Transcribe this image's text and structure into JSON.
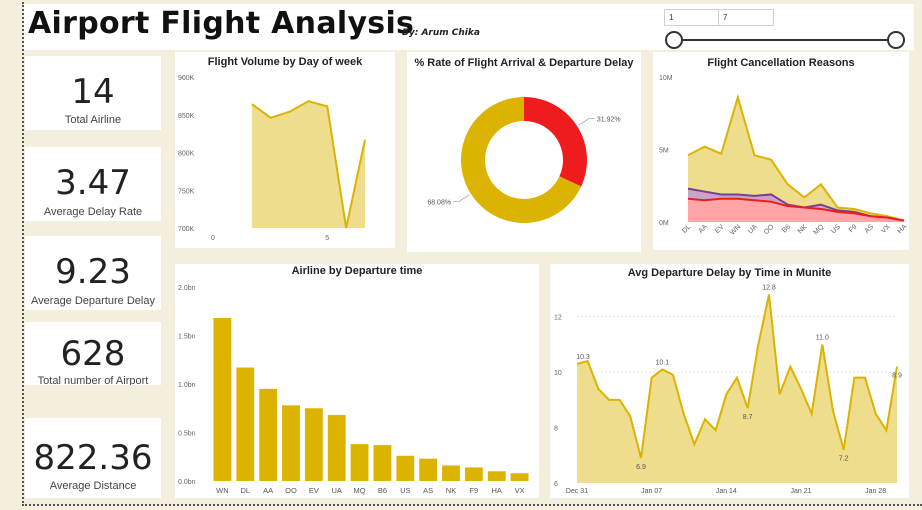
{
  "header": {
    "title": "Airport Flight Analysis",
    "byline": "By: Arum Chika"
  },
  "slicer": {
    "min": "1",
    "max": "7"
  },
  "colors": {
    "gold": "#dbb300",
    "goldFill": "#eedd8c",
    "red": "#ee1c1c",
    "purple": "#7b3f8f",
    "salmon": "#ffa5a5"
  },
  "kpis": [
    {
      "value": "14",
      "label": "Total Airline"
    },
    {
      "value": "3.47",
      "label": "Average Delay Rate"
    },
    {
      "value": "9.23",
      "label": "Average Departure Delay"
    },
    {
      "value": "628",
      "label": "Total number of  Airport"
    },
    {
      "value": "822.36",
      "label": "Average Distance"
    }
  ],
  "chart_data": [
    {
      "id": "volume",
      "type": "area",
      "title": "Flight Volume by Day of week",
      "x": [
        1,
        2,
        3,
        4,
        5,
        6,
        7
      ],
      "y": [
        864000,
        846000,
        854000,
        868000,
        861000,
        700000,
        817000
      ],
      "ylim": [
        700000,
        900000
      ],
      "yticks": [
        "900K",
        "850K",
        "800K",
        "750K",
        "700K"
      ],
      "xticks": [
        "0",
        "5"
      ],
      "xlim": [
        0,
        7
      ]
    },
    {
      "id": "donut",
      "type": "pie",
      "title": "% Rate of Flight Arrival & Departure Delay",
      "slices": [
        {
          "label": "31.92%",
          "value": 31.92,
          "color": "#ee1c1c"
        },
        {
          "label": "68.08%",
          "value": 68.08,
          "color": "#dbb300"
        }
      ]
    },
    {
      "id": "cancel",
      "type": "area",
      "title": "Flight Cancellation Reasons",
      "categories": [
        "DL",
        "AA",
        "EV",
        "WN",
        "UA",
        "OO",
        "B6",
        "NK",
        "MQ",
        "US",
        "F9",
        "AS",
        "VX",
        "HA"
      ],
      "series": [
        {
          "values": [
            4.6,
            5.2,
            4.7,
            8.6,
            4.6,
            4.3,
            2.6,
            1.7,
            2.6,
            1.0,
            0.9,
            0.6,
            0.4,
            0.1
          ]
        },
        {
          "values": [
            2.3,
            2.1,
            1.9,
            1.9,
            1.8,
            1.9,
            1.2,
            1.0,
            1.2,
            0.8,
            0.7,
            0.4,
            0.3,
            0.1
          ]
        },
        {
          "values": [
            1.6,
            1.5,
            1.6,
            1.6,
            1.5,
            1.4,
            1.1,
            1.0,
            0.9,
            0.7,
            0.6,
            0.4,
            0.3,
            0.1
          ]
        }
      ],
      "ylim": [
        0,
        10
      ],
      "yticks": [
        "10M",
        "5M",
        "0M"
      ]
    },
    {
      "id": "airline",
      "type": "bar",
      "title": "Airline by Departure time",
      "categories": [
        "WN",
        "DL",
        "AA",
        "OO",
        "EV",
        "UA",
        "MQ",
        "B6",
        "US",
        "AS",
        "NK",
        "F9",
        "HA",
        "VX"
      ],
      "values": [
        1.68,
        1.17,
        0.95,
        0.78,
        0.75,
        0.68,
        0.38,
        0.37,
        0.26,
        0.23,
        0.16,
        0.14,
        0.1,
        0.08
      ],
      "ylim": [
        0,
        2.0
      ],
      "yticks": [
        "2.0bn",
        "1.5bn",
        "1.0bn",
        "0.5bn",
        "0.0bn"
      ]
    },
    {
      "id": "delay",
      "type": "area",
      "title": "Avg Departure Delay by Time in Munite",
      "x": [
        0,
        1,
        2,
        3,
        4,
        5,
        6,
        7,
        8,
        9,
        10,
        11,
        12,
        13,
        14,
        15,
        16,
        17,
        18,
        19,
        20,
        21,
        22,
        23,
        24,
        25,
        26,
        27,
        28,
        29,
        30
      ],
      "y": [
        10.3,
        10.4,
        9.4,
        9.0,
        9.0,
        8.4,
        6.9,
        9.8,
        10.1,
        9.9,
        8.5,
        7.4,
        8.3,
        7.9,
        9.2,
        9.8,
        8.7,
        11.0,
        12.8,
        9.2,
        10.2,
        9.4,
        8.5,
        11.0,
        8.6,
        7.2,
        9.8,
        9.8,
        8.5,
        7.9,
        10.2
      ],
      "ylim": [
        6,
        13
      ],
      "yticks": [
        "12",
        "10",
        "8",
        "6"
      ],
      "xtick_labels": [
        "Dec 31",
        "Jan 07",
        "Jan 14",
        "Jan 21",
        "Jan 28"
      ],
      "data_labels": [
        "10.3",
        "6.9",
        "10.1",
        "8.7",
        "12.8",
        "11.0",
        "7.2",
        "8.9"
      ]
    }
  ]
}
